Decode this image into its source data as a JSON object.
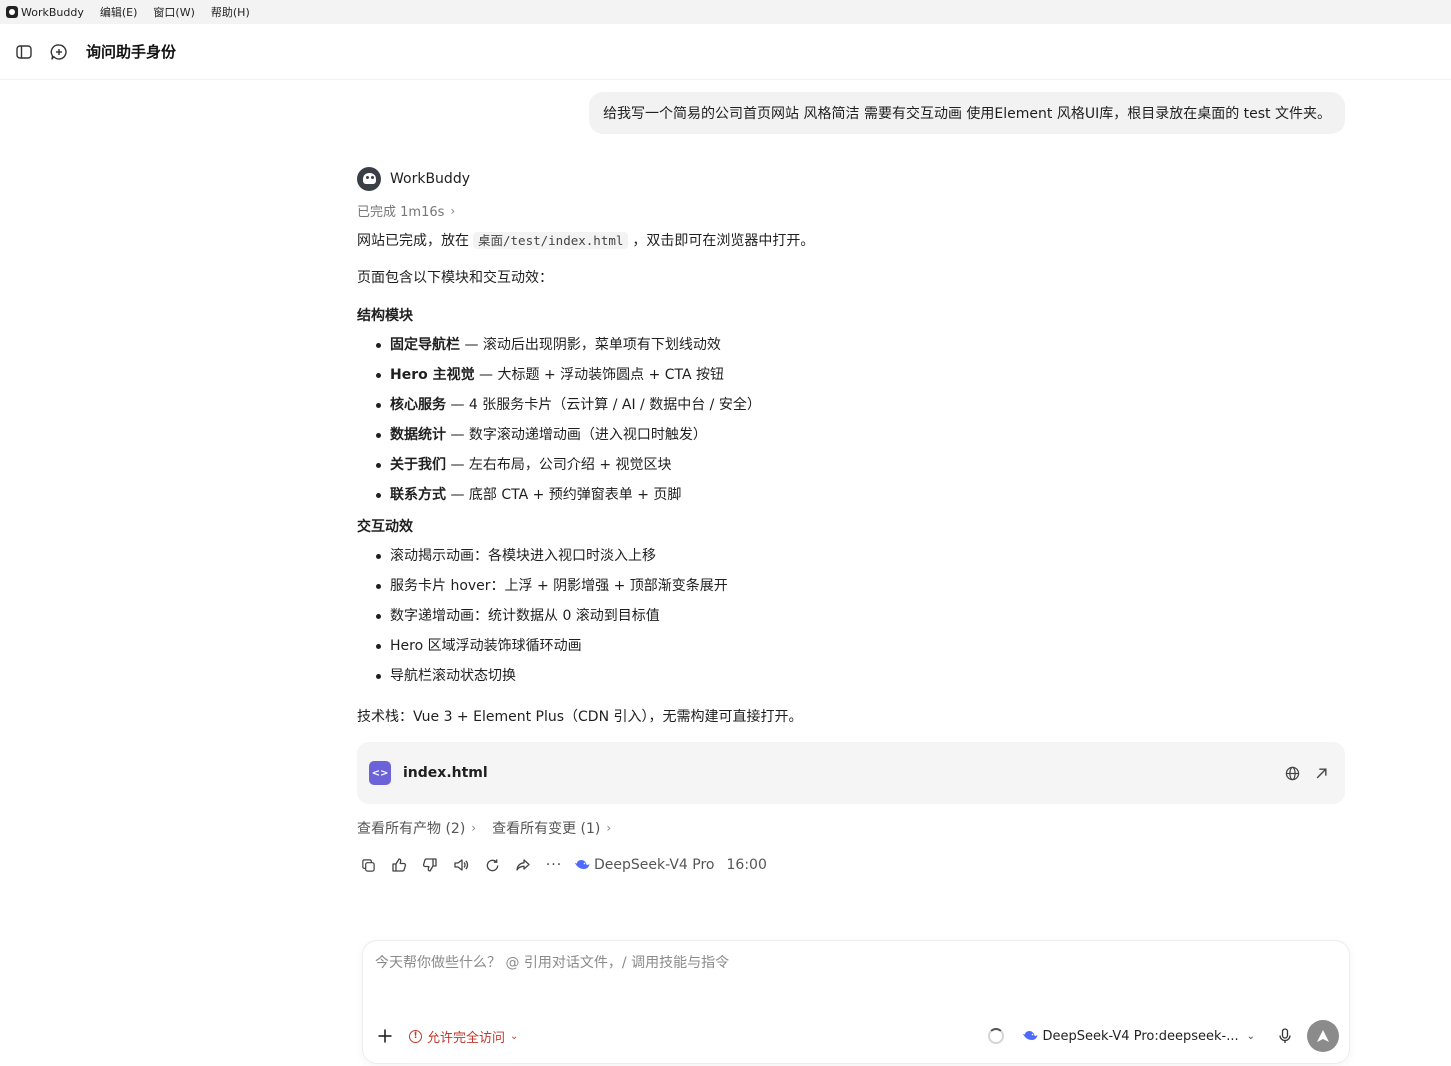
{
  "menubar": {
    "app_name": "WorkBuddy",
    "items": [
      "编辑(E)",
      "窗口(W)",
      "帮助(H)"
    ]
  },
  "header": {
    "title": "询问助手身份"
  },
  "conversation": {
    "user_message": "给我写一个简易的公司首页网站 风格简洁 需要有交互动画 使用Element 风格UI库，根目录放在桌面的 test 文件夹。",
    "assistant": {
      "name": "WorkBuddy",
      "status": "已完成 1m16s",
      "p1_before": "网站已完成，放在",
      "p1_code": "桌面/test/index.html",
      "p1_after": "，双击即可在浏览器中打开。",
      "p2": "页面包含以下模块和交互动效：",
      "section1_title": "结构模块",
      "section1_items": [
        {
          "bold": "固定导航栏",
          "text": " — 滚动后出现阴影，菜单项有下划线动效"
        },
        {
          "bold": "Hero 主视觉",
          "text": " — 大标题 + 浮动装饰圆点 + CTA 按钮"
        },
        {
          "bold": "核心服务",
          "text": " — 4 张服务卡片（云计算 / AI / 数据中台 / 安全）"
        },
        {
          "bold": "数据统计",
          "text": " — 数字滚动递增动画（进入视口时触发）"
        },
        {
          "bold": "关于我们",
          "text": " — 左右布局，公司介绍 + 视觉区块"
        },
        {
          "bold": "联系方式",
          "text": " — 底部 CTA + 预约弹窗表单 + 页脚"
        }
      ],
      "section2_title": "交互动效",
      "section2_items": [
        "滚动揭示动画：各模块进入视口时淡入上移",
        "服务卡片 hover：上浮 + 阴影增强 + 顶部渐变条展开",
        "数字递增动画：统计数据从 0 滚动到目标值",
        "Hero 区域浮动装饰球循环动画",
        "导航栏滚动状态切换"
      ],
      "tech_stack": "技术栈：Vue 3 + Element Plus（CDN 引入），无需构建可直接打开。",
      "file": {
        "name": "index.html",
        "icon": "code-file-icon"
      },
      "links": {
        "artifacts": "查看所有产物 (2)",
        "changes": "查看所有变更 (1)"
      },
      "model": "DeepSeek-V4 Pro",
      "time": "16:00"
    }
  },
  "composer": {
    "placeholder": "今天帮你做些什么？ @ 引用对话文件，/ 调用技能与指令",
    "access_label": "允许完全访问",
    "model_label": "DeepSeek-V4 Pro:deepseek-...",
    "accent_color": "#c0392b"
  }
}
